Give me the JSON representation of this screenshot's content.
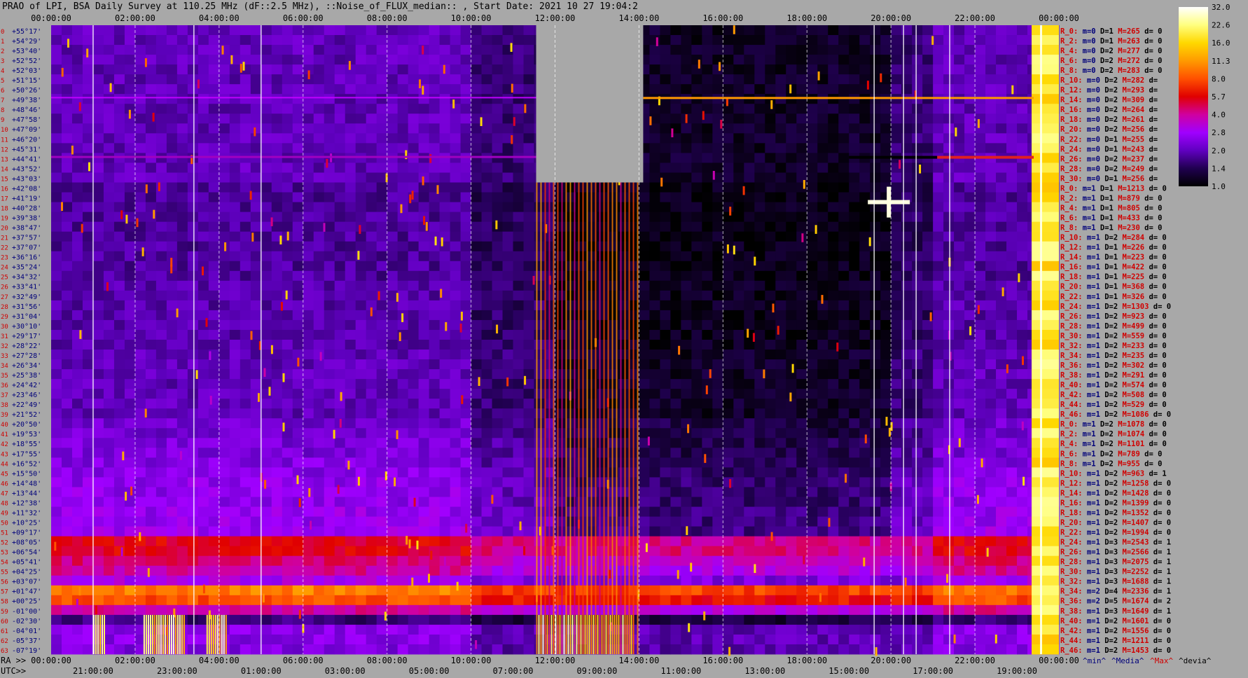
{
  "title": "PRAO of LPI, BSA Daily Survey at 110.25 MHz (dF::2.5 MHz), ::Noise_of_FLUX_median:: , Start Date: 2021 10 27 19:04:2",
  "chart_data": {
    "type": "heatmap",
    "top_time_ticks": [
      "00:00:00",
      "02:00:00",
      "04:00:00",
      "06:00:00",
      "08:00:00",
      "10:00:00",
      "12:00:00",
      "14:00:00",
      "16:00:00",
      "18:00:00",
      "20:00:00",
      "22:00:00",
      "00:00:00"
    ],
    "ra_row_label": "RA >>",
    "ra_ticks": [
      "00:00:00",
      "02:00:00",
      "04:00:00",
      "06:00:00",
      "08:00:00",
      "10:00:00",
      "12:00:00",
      "14:00:00",
      "16:00:00",
      "18:00:00",
      "20:00:00",
      "22:00:00",
      "00:00:00"
    ],
    "utc_row_label": "UTC>>",
    "utc_ticks": [
      "21:00:00",
      "23:00:00",
      "01:00:00",
      "03:00:00",
      "05:00:00",
      "07:00:00",
      "09:00:00",
      "11:00:00",
      "13:00:00",
      "15:00:00",
      "17:00:00",
      "19:00:00"
    ],
    "colorbar": {
      "labels": [
        "32.0",
        "22.6",
        "16.0",
        "11.3",
        "8.0",
        "5.7",
        "4.0",
        "2.8",
        "2.0",
        "1.4",
        "1.0"
      ],
      "colors": [
        "#ffffff",
        "#ffff80",
        "#ffd800",
        "#ff9a00",
        "#ff5000",
        "#e00000",
        "#d000a0",
        "#a000ff",
        "#6000c0",
        "#200050",
        "#000000"
      ]
    },
    "beams": [
      {
        "idx": "0",
        "dec": "+55°17'"
      },
      {
        "idx": "1",
        "dec": "+54°29'"
      },
      {
        "idx": "2",
        "dec": "+53°40'"
      },
      {
        "idx": "3",
        "dec": "+52°52'"
      },
      {
        "idx": "4",
        "dec": "+52°03'"
      },
      {
        "idx": "5",
        "dec": "+51°15'"
      },
      {
        "idx": "6",
        "dec": "+50°26'"
      },
      {
        "idx": "7",
        "dec": "+49°38'"
      },
      {
        "idx": "8",
        "dec": "+48°46'"
      },
      {
        "idx": "9",
        "dec": "+47°58'"
      },
      {
        "idx": "10",
        "dec": "+47°09'"
      },
      {
        "idx": "11",
        "dec": "+46°20'"
      },
      {
        "idx": "12",
        "dec": "+45°31'"
      },
      {
        "idx": "13",
        "dec": "+44°41'"
      },
      {
        "idx": "14",
        "dec": "+43°52'"
      },
      {
        "idx": "15",
        "dec": "+43°03'"
      },
      {
        "idx": "16",
        "dec": "+42°08'"
      },
      {
        "idx": "17",
        "dec": "+41°19'"
      },
      {
        "idx": "18",
        "dec": "+40°28'"
      },
      {
        "idx": "19",
        "dec": "+39°38'"
      },
      {
        "idx": "20",
        "dec": "+38°47'"
      },
      {
        "idx": "21",
        "dec": "+37°57'"
      },
      {
        "idx": "22",
        "dec": "+37°07'"
      },
      {
        "idx": "23",
        "dec": "+36°16'"
      },
      {
        "idx": "24",
        "dec": "+35°24'"
      },
      {
        "idx": "25",
        "dec": "+34°32'"
      },
      {
        "idx": "26",
        "dec": "+33°41'"
      },
      {
        "idx": "27",
        "dec": "+32°49'"
      },
      {
        "idx": "28",
        "dec": "+31°56'"
      },
      {
        "idx": "29",
        "dec": "+31°04'"
      },
      {
        "idx": "30",
        "dec": "+30°10'"
      },
      {
        "idx": "31",
        "dec": "+29°17'"
      },
      {
        "idx": "32",
        "dec": "+28°22'"
      },
      {
        "idx": "33",
        "dec": "+27°28'"
      },
      {
        "idx": "34",
        "dec": "+26°34'"
      },
      {
        "idx": "35",
        "dec": "+25°38'"
      },
      {
        "idx": "36",
        "dec": "+24°42'"
      },
      {
        "idx": "37",
        "dec": "+23°46'"
      },
      {
        "idx": "38",
        "dec": "+22°49'"
      },
      {
        "idx": "39",
        "dec": "+21°52'"
      },
      {
        "idx": "40",
        "dec": "+20°50'"
      },
      {
        "idx": "41",
        "dec": "+19°53'"
      },
      {
        "idx": "42",
        "dec": "+18°55'"
      },
      {
        "idx": "43",
        "dec": "+17°55'"
      },
      {
        "idx": "44",
        "dec": "+16°52'"
      },
      {
        "idx": "45",
        "dec": "+15°50'"
      },
      {
        "idx": "46",
        "dec": "+14°48'"
      },
      {
        "idx": "47",
        "dec": "+13°44'"
      },
      {
        "idx": "48",
        "dec": "+12°38'"
      },
      {
        "idx": "49",
        "dec": "+11°32'"
      },
      {
        "idx": "50",
        "dec": "+10°25'"
      },
      {
        "idx": "51",
        "dec": "+09°17'"
      },
      {
        "idx": "52",
        "dec": "+08°05'"
      },
      {
        "idx": "53",
        "dec": "+06°54'"
      },
      {
        "idx": "54",
        "dec": "+05°41'"
      },
      {
        "idx": "55",
        "dec": "+04°25'"
      },
      {
        "idx": "56",
        "dec": "+03°07'"
      },
      {
        "idx": "57",
        "dec": "+01°47'"
      },
      {
        "idx": "58",
        "dec": "+00°25'"
      },
      {
        "idx": "59",
        "dec": "-01°00'"
      },
      {
        "idx": "60",
        "dec": "-02°30'"
      },
      {
        "idx": "61",
        "dec": "-04°01'"
      },
      {
        "idx": "62",
        "dec": "-05°37'"
      },
      {
        "idx": "63",
        "dec": "-07°19'"
      }
    ],
    "stats": [
      {
        "R": "R_0:",
        "m": "m=0",
        "D": "D=1",
        "M": "M=265",
        "d": "d= 0"
      },
      {
        "R": "R_2:",
        "m": "m=0",
        "D": "D=1",
        "M": "M=263",
        "d": "d= 0"
      },
      {
        "R": "R_4:",
        "m": "m=0",
        "D": "D=2",
        "M": "M=277",
        "d": "d= 0"
      },
      {
        "R": "R_6:",
        "m": "m=0",
        "D": "D=2",
        "M": "M=272",
        "d": "d= 0"
      },
      {
        "R": "R_8:",
        "m": "m=0",
        "D": "D=2",
        "M": "M=283",
        "d": "d= 0"
      },
      {
        "R": "R_10:",
        "m": "m=0",
        "D": "D=2",
        "M": "M=282",
        "d": "d="
      },
      {
        "R": "R_12:",
        "m": "m=0",
        "D": "D=2",
        "M": "M=293",
        "d": "d="
      },
      {
        "R": "R_14:",
        "m": "m=0",
        "D": "D=2",
        "M": "M=309",
        "d": "d="
      },
      {
        "R": "R_16:",
        "m": "m=0",
        "D": "D=2",
        "M": "M=264",
        "d": "d="
      },
      {
        "R": "R_18:",
        "m": "m=0",
        "D": "D=2",
        "M": "M=261",
        "d": "d="
      },
      {
        "R": "R_20:",
        "m": "m=0",
        "D": "D=2",
        "M": "M=256",
        "d": "d="
      },
      {
        "R": "R_22:",
        "m": "m=0",
        "D": "D=1",
        "M": "M=255",
        "d": "d="
      },
      {
        "R": "R_24:",
        "m": "m=0",
        "D": "D=1",
        "M": "M=243",
        "d": "d="
      },
      {
        "R": "R_26:",
        "m": "m=0",
        "D": "D=2",
        "M": "M=237",
        "d": "d="
      },
      {
        "R": "R_28:",
        "m": "m=0",
        "D": "D=2",
        "M": "M=249",
        "d": "d="
      },
      {
        "R": "R_30:",
        "m": "m=0",
        "D": "D=1",
        "M": "M=256",
        "d": "d="
      },
      {
        "R": "R_0:",
        "m": "m=1",
        "D": "D=1",
        "M": "M=1213",
        "d": "d= 0"
      },
      {
        "R": "R_2:",
        "m": "m=1",
        "D": "D=1",
        "M": "M=879",
        "d": "d= 0"
      },
      {
        "R": "R_4:",
        "m": "m=1",
        "D": "D=1",
        "M": "M=805",
        "d": "d= 0"
      },
      {
        "R": "R_6:",
        "m": "m=1",
        "D": "D=1",
        "M": "M=433",
        "d": "d= 0"
      },
      {
        "R": "R_8:",
        "m": "m=1",
        "D": "D=1",
        "M": "M=230",
        "d": "d= 0"
      },
      {
        "R": "R_10:",
        "m": "m=1",
        "D": "D=2",
        "M": "M=284",
        "d": "d= 0"
      },
      {
        "R": "R_12:",
        "m": "m=1",
        "D": "D=1",
        "M": "M=226",
        "d": "d= 0"
      },
      {
        "R": "R_14:",
        "m": "m=1",
        "D": "D=1",
        "M": "M=223",
        "d": "d= 0"
      },
      {
        "R": "R_16:",
        "m": "m=1",
        "D": "D=1",
        "M": "M=422",
        "d": "d= 0"
      },
      {
        "R": "R_18:",
        "m": "m=1",
        "D": "D=1",
        "M": "M=225",
        "d": "d= 0"
      },
      {
        "R": "R_20:",
        "m": "m=1",
        "D": "D=1",
        "M": "M=368",
        "d": "d= 0"
      },
      {
        "R": "R_22:",
        "m": "m=1",
        "D": "D=1",
        "M": "M=326",
        "d": "d= 0"
      },
      {
        "R": "R_24:",
        "m": "m=1",
        "D": "D=2",
        "M": "M=1303",
        "d": "d= 0"
      },
      {
        "R": "R_26:",
        "m": "m=1",
        "D": "D=2",
        "M": "M=923",
        "d": "d= 0"
      },
      {
        "R": "R_28:",
        "m": "m=1",
        "D": "D=2",
        "M": "M=499",
        "d": "d= 0"
      },
      {
        "R": "R_30:",
        "m": "m=1",
        "D": "D=2",
        "M": "M=559",
        "d": "d= 0"
      },
      {
        "R": "R_32:",
        "m": "m=1",
        "D": "D=2",
        "M": "M=233",
        "d": "d= 0"
      },
      {
        "R": "R_34:",
        "m": "m=1",
        "D": "D=2",
        "M": "M=235",
        "d": "d= 0"
      },
      {
        "R": "R_36:",
        "m": "m=1",
        "D": "D=2",
        "M": "M=302",
        "d": "d= 0"
      },
      {
        "R": "R_38:",
        "m": "m=1",
        "D": "D=2",
        "M": "M=291",
        "d": "d= 0"
      },
      {
        "R": "R_40:",
        "m": "m=1",
        "D": "D=2",
        "M": "M=574",
        "d": "d= 0"
      },
      {
        "R": "R_42:",
        "m": "m=1",
        "D": "D=2",
        "M": "M=508",
        "d": "d= 0"
      },
      {
        "R": "R_44:",
        "m": "m=1",
        "D": "D=2",
        "M": "M=529",
        "d": "d= 0"
      },
      {
        "R": "R_46:",
        "m": "m=1",
        "D": "D=2",
        "M": "M=1086",
        "d": "d= 0"
      },
      {
        "R": "R_0:",
        "m": "m=1",
        "D": "D=2",
        "M": "M=1078",
        "d": "d= 0"
      },
      {
        "R": "R_2:",
        "m": "m=1",
        "D": "D=2",
        "M": "M=1074",
        "d": "d= 0"
      },
      {
        "R": "R_4:",
        "m": "m=1",
        "D": "D=2",
        "M": "M=1101",
        "d": "d= 0"
      },
      {
        "R": "R_6:",
        "m": "m=1",
        "D": "D=2",
        "M": "M=789",
        "d": "d= 0"
      },
      {
        "R": "R_8:",
        "m": "m=1",
        "D": "D=2",
        "M": "M=955",
        "d": "d= 0"
      },
      {
        "R": "R_10:",
        "m": "m=1",
        "D": "D=2",
        "M": "M=963",
        "d": "d= 1"
      },
      {
        "R": "R_12:",
        "m": "m=1",
        "D": "D=2",
        "M": "M=1258",
        "d": "d= 0"
      },
      {
        "R": "R_14:",
        "m": "m=1",
        "D": "D=2",
        "M": "M=1428",
        "d": "d= 0"
      },
      {
        "R": "R_16:",
        "m": "m=1",
        "D": "D=2",
        "M": "M=1399",
        "d": "d= 0"
      },
      {
        "R": "R_18:",
        "m": "m=1",
        "D": "D=2",
        "M": "M=1352",
        "d": "d= 0"
      },
      {
        "R": "R_20:",
        "m": "m=1",
        "D": "D=2",
        "M": "M=1407",
        "d": "d= 0"
      },
      {
        "R": "R_22:",
        "m": "m=1",
        "D": "D=2",
        "M": "M=1994",
        "d": "d= 0"
      },
      {
        "R": "R_24:",
        "m": "m=1",
        "D": "D=3",
        "M": "M=2543",
        "d": "d= 1"
      },
      {
        "R": "R_26:",
        "m": "m=1",
        "D": "D=3",
        "M": "M=2566",
        "d": "d= 1"
      },
      {
        "R": "R_28:",
        "m": "m=1",
        "D": "D=3",
        "M": "M=2075",
        "d": "d= 1"
      },
      {
        "R": "R_30:",
        "m": "m=1",
        "D": "D=3",
        "M": "M=2252",
        "d": "d= 1"
      },
      {
        "R": "R_32:",
        "m": "m=1",
        "D": "D=3",
        "M": "M=1688",
        "d": "d= 1"
      },
      {
        "R": "R_34:",
        "m": "m=2",
        "D": "D=4",
        "M": "M=2336",
        "d": "d= 1"
      },
      {
        "R": "R_36:",
        "m": "m=2",
        "D": "D=5",
        "M": "M=1674",
        "d": "d= 2"
      },
      {
        "R": "R_38:",
        "m": "m=1",
        "D": "D=3",
        "M": "M=1649",
        "d": "d= 1"
      },
      {
        "R": "R_40:",
        "m": "m=1",
        "D": "D=2",
        "M": "M=1601",
        "d": "d= 0"
      },
      {
        "R": "R_42:",
        "m": "m=1",
        "D": "D=2",
        "M": "M=1556",
        "d": "d= 0"
      },
      {
        "R": "R_44:",
        "m": "m=1",
        "D": "D=2",
        "M": "M=1211",
        "d": "d= 0"
      },
      {
        "R": "R_46:",
        "m": "m=1",
        "D": "D=2",
        "M": "M=1453",
        "d": "d= 0"
      }
    ],
    "footer_legend": [
      "^min^",
      "^Media^",
      "^Max^",
      "^devia^"
    ],
    "row_level_profile": [
      2,
      2,
      2,
      2,
      2,
      2,
      2,
      2,
      2,
      2,
      2,
      2,
      2,
      2,
      2,
      2,
      1.8,
      1.8,
      1.8,
      1.8,
      1.8,
      1.8,
      1.8,
      1.8,
      1.8,
      1.8,
      1.9,
      1.9,
      1.9,
      1.9,
      1.9,
      1.9,
      1.9,
      2,
      2,
      2,
      2,
      2,
      2,
      2,
      2.2,
      2.2,
      2.3,
      2.3,
      2.4,
      2.5,
      2.6,
      2.6,
      2.6,
      2.7,
      2.7,
      2.8,
      5.5,
      5.5,
      4.5,
      4,
      3,
      10,
      8,
      4,
      1.6,
      2.5,
      2.5,
      2.4
    ],
    "sun_column_hours": [
      23.35,
      24.0
    ],
    "gap_block": {
      "x_hours": [
        11.55,
        14.1
      ],
      "beams": [
        0,
        16
      ]
    },
    "bright_bottom_segments_hours": [
      [
        1.0,
        1.3
      ],
      [
        2.2,
        3.2
      ],
      [
        3.7,
        4.2
      ],
      [
        11.6,
        13.9
      ]
    ]
  }
}
